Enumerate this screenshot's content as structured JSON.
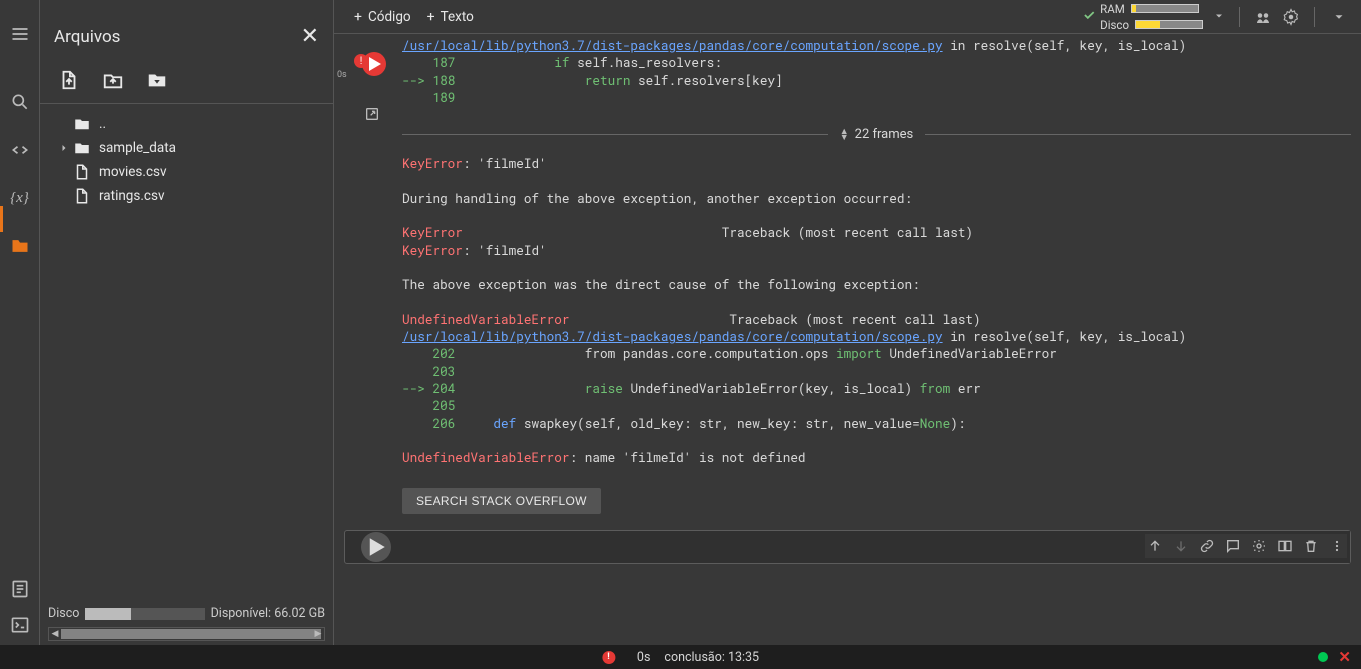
{
  "file_panel": {
    "title": "Arquivos",
    "items": [
      {
        "icon": "folder-up",
        "label": ".."
      },
      {
        "icon": "folder",
        "label": "sample_data",
        "expandable": true
      },
      {
        "icon": "file",
        "label": "movies.csv"
      },
      {
        "icon": "file",
        "label": "ratings.csv"
      }
    ],
    "disk_label": "Disco",
    "disk_available": "Disponível: 66.02 GB"
  },
  "toolbar": {
    "code_label": "Código",
    "text_label": "Texto",
    "ram_label": "RAM",
    "disk_label": "Disco"
  },
  "gutter": {
    "time": "0s"
  },
  "traceback": {
    "top_link": "/usr/local/lib/python3.7/dist-packages/pandas/core/computation/scope.py",
    "top_tail": " in resolve(self, key, is_local)",
    "l187_num": "187",
    "l187_code": "            if self.has_resolvers:",
    "l188_arrow": "--> ",
    "l188_num": "188",
    "l188_code": "                return self.resolvers[key]",
    "l189_num": "189",
    "frames_label": "22 frames",
    "keyerror1": "KeyError",
    "keyerror1_msg": ": 'filmeId'",
    "during": "During handling of the above exception, another exception occurred:",
    "keyerror2": "KeyError",
    "keyerror2_trace": "                                  Traceback (most recent call last)",
    "keyerror3": "KeyError",
    "keyerror3_msg": ": 'filmeId'",
    "above": "The above exception was the direct cause of the following exception:",
    "uverr": "UndefinedVariableError",
    "uverr_trace": "                     Traceback (most recent call last)",
    "link2": "/usr/local/lib/python3.7/dist-packages/pandas/core/computation/scope.py",
    "link2_tail": " in resolve(self, key, is_local)",
    "l202_num": "202",
    "l202_code_a": "                from pandas.core.computation.ops ",
    "l202_import": "import",
    "l202_code_b": " UndefinedVariableError",
    "l203_num": "203",
    "l204_arrow": "--> ",
    "l204_num": "204",
    "l204_code_a": "                raise UndefinedVariableError(key, is_local) ",
    "l204_from": "from",
    "l204_code_b": " err",
    "l205_num": "205",
    "l206_num": "206",
    "l206_code_a": "    def",
    "l206_code_b": " swapkey(self, old_key: str, new_key: str, new_value=",
    "l206_none": "None",
    "l206_code_c": "):",
    "final_err": "UndefinedVariableError",
    "final_msg": ": name 'filmeId' is not defined",
    "stack_btn": "SEARCH STACK OVERFLOW"
  },
  "status": {
    "time": "0s",
    "completion": "conclusão: 13:35"
  }
}
